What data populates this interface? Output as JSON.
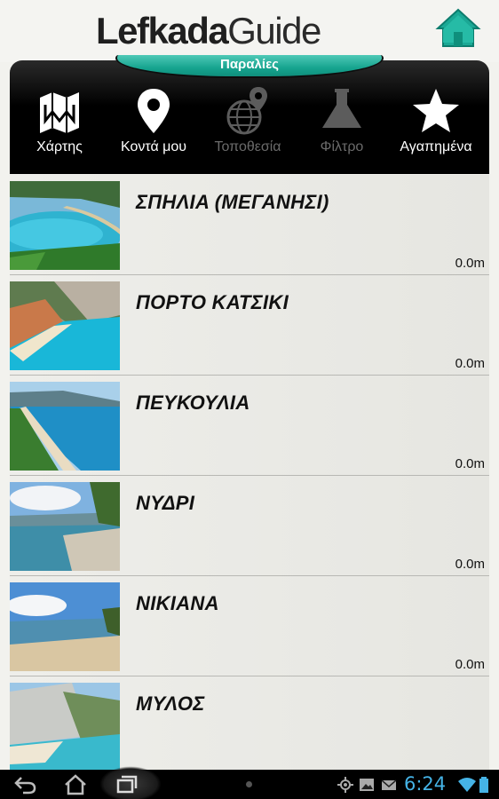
{
  "app": {
    "logo_bold": "Lefkada",
    "logo_light": "Guide",
    "section": "Παραλίες"
  },
  "toolbar": {
    "items": [
      {
        "label": "Χάρτης",
        "icon": "map-icon",
        "enabled": true
      },
      {
        "label": "Κοντά μου",
        "icon": "location-pin-icon",
        "enabled": true
      },
      {
        "label": "Τοποθεσία",
        "icon": "globe-pin-icon",
        "enabled": false
      },
      {
        "label": "Φίλτρο",
        "icon": "flask-icon",
        "enabled": false
      },
      {
        "label": "Αγαπημένα",
        "icon": "star-icon",
        "enabled": true
      }
    ]
  },
  "beaches": [
    {
      "name": "ΣΠΗΛΙΑ (ΜΕΓΑΝΗΣΙ)",
      "distance": "0.0m"
    },
    {
      "name": "ΠΟΡΤΟ ΚΑΤΣΙΚΙ",
      "distance": "0.0m"
    },
    {
      "name": "ΠΕΥΚΟΥΛΙΑ",
      "distance": "0.0m"
    },
    {
      "name": "ΝΥΔΡΙ",
      "distance": "0.0m"
    },
    {
      "name": "ΝΙΚΙΑΝΑ",
      "distance": "0.0m"
    },
    {
      "name": "ΜΥΛΟΣ",
      "distance": ""
    }
  ],
  "system": {
    "time": "6:24",
    "accent": "#45b3e6",
    "icons": [
      "back-icon",
      "home-icon",
      "recent-apps-icon",
      "gps-icon",
      "image-icon",
      "mail-icon",
      "wifi-icon",
      "battery-icon"
    ]
  },
  "colors": {
    "teal": "#16a48f",
    "toolbar": "#000000"
  }
}
